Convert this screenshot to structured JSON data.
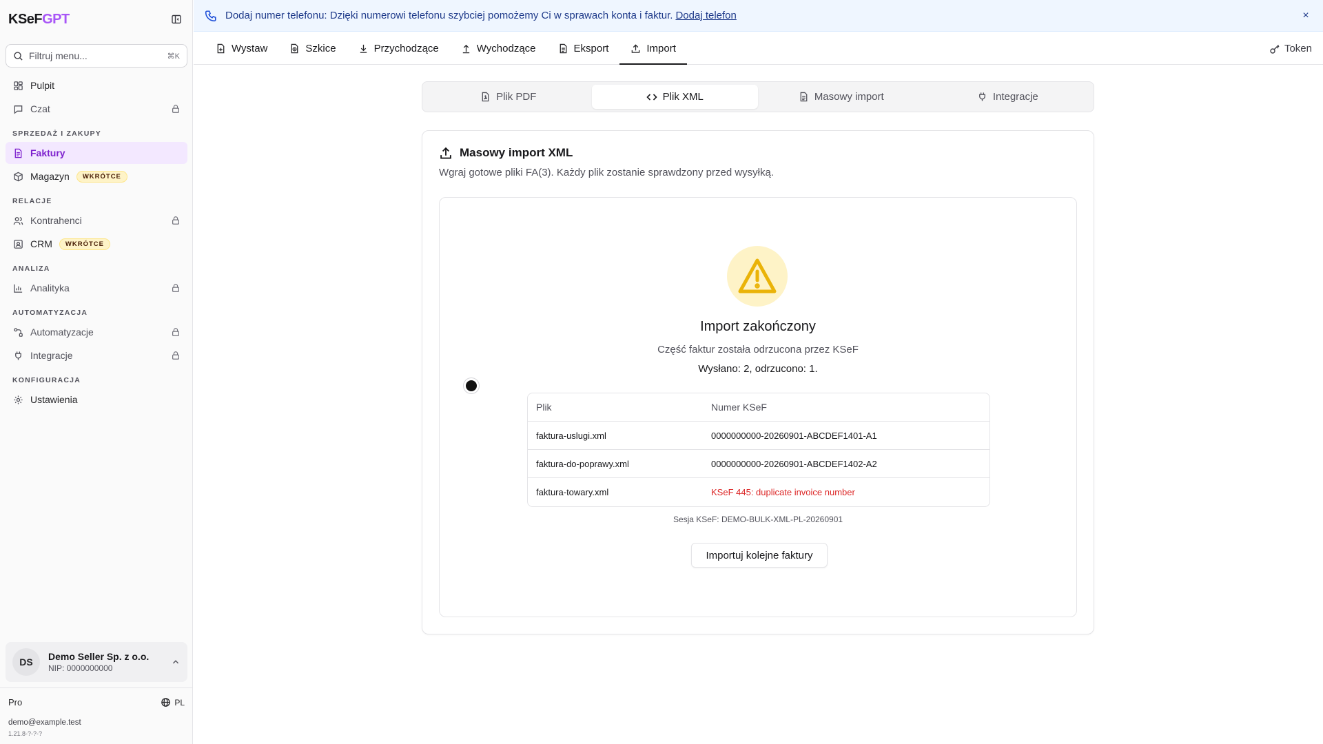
{
  "app": {
    "logo_main": "KSeF",
    "logo_accent": "GPT"
  },
  "sidebar": {
    "search_placeholder": "Filtruj menu...",
    "search_shortcut": "⌘K",
    "items_top": [
      {
        "label": "Pulpit",
        "icon": "grid-icon"
      },
      {
        "label": "Czat",
        "icon": "chat-icon",
        "locked": true
      }
    ],
    "sections": [
      {
        "title": "SPRZEDAŻ I ZAKUPY",
        "items": [
          {
            "label": "Faktury",
            "active": true
          },
          {
            "label": "Magazyn",
            "badge": "WKRÓTCE"
          }
        ]
      },
      {
        "title": "RELACJE",
        "items": [
          {
            "label": "Kontrahenci",
            "locked": true
          },
          {
            "label": "CRM",
            "badge": "WKRÓTCE"
          }
        ]
      },
      {
        "title": "ANALIZA",
        "items": [
          {
            "label": "Analityka",
            "locked": true
          }
        ]
      },
      {
        "title": "AUTOMATYZACJA",
        "items": [
          {
            "label": "Automatyzacje",
            "locked": true
          },
          {
            "label": "Integracje",
            "locked": true
          }
        ]
      },
      {
        "title": "KONFIGURACJA",
        "items": [
          {
            "label": "Ustawienia"
          }
        ]
      }
    ],
    "account": {
      "initials": "DS",
      "name": "Demo Seller Sp. z o.o.",
      "nip": "NIP: 0000000000"
    },
    "plan": "Pro",
    "language": "PL",
    "email": "demo@example.test",
    "version": "1.21.8-?-?-?"
  },
  "banner": {
    "message": "Dodaj numer telefonu: Dzięki numerowi telefonu szybciej pomożemy Ci w sprawach konta i faktur.",
    "link": "Dodaj telefon",
    "close": "×"
  },
  "topnav": {
    "tabs": [
      {
        "label": "Wystaw"
      },
      {
        "label": "Szkice"
      },
      {
        "label": "Przychodzące"
      },
      {
        "label": "Wychodzące"
      },
      {
        "label": "Eksport"
      },
      {
        "label": "Import",
        "active": true
      }
    ],
    "token": "Token"
  },
  "import_tabs": [
    {
      "label": "Plik PDF"
    },
    {
      "label": "Plik XML",
      "active": true
    },
    {
      "label": "Masowy import"
    },
    {
      "label": "Integracje"
    }
  ],
  "card": {
    "title": "Masowy import XML",
    "description": "Wgraj gotowe pliki FA(3). Każdy plik zostanie sprawdzony przed wysyłką."
  },
  "result": {
    "title": "Import zakończony",
    "subtitle": "Część faktur została odrzucona przez KSeF",
    "counts": "Wysłano: 2, odrzucono: 1.",
    "table": {
      "headers": [
        "Plik",
        "Numer KSeF"
      ],
      "rows": [
        {
          "file": "faktura-uslugi.xml",
          "ksef": "0000000000-20260901-ABCDEF1401-A1",
          "error": false
        },
        {
          "file": "faktura-do-poprawy.xml",
          "ksef": "0000000000-20260901-ABCDEF1402-A2",
          "error": false
        },
        {
          "file": "faktura-towary.xml",
          "ksef": "KSeF 445: duplicate invoice number",
          "error": true
        }
      ]
    },
    "session": "Sesja KSeF: DEMO-BULK-XML-PL-20260901",
    "button": "Importuj kolejne faktury"
  },
  "colors": {
    "accent": "#a855f7",
    "active_bg": "#f3e8ff",
    "active_fg": "#7e22ce",
    "banner_bg": "#eff6ff",
    "warning": "#eab308",
    "error": "#dc2626"
  }
}
